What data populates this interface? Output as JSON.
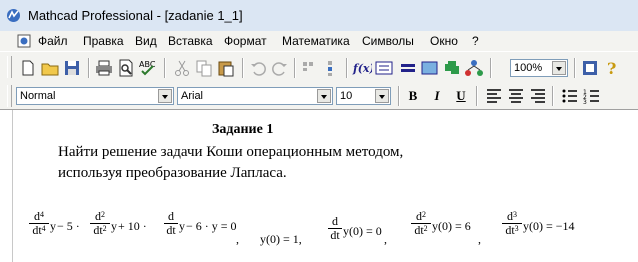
{
  "window": {
    "title": "Mathcad Professional - [zadanie 1_1]"
  },
  "menu": [
    "Файл",
    "Правка",
    "Вид",
    "Вставка",
    "Формат",
    "Математика",
    "Символы",
    "Окно",
    "?"
  ],
  "toolbar": {
    "zoom": "100%"
  },
  "formatbar": {
    "style": "Normal",
    "font": "Arial",
    "size": "10",
    "bold": "B",
    "italic": "I",
    "underline": "U"
  },
  "document": {
    "heading": "Задание 1",
    "line1": "Найти решение задачи Коши операционным методом,",
    "line2": "используя преобразование Лапласа.",
    "equation": {
      "d": "d",
      "dt": "dt",
      "p4": "4",
      "p2": "2",
      "p3": "3",
      "y": "y",
      "minus5": " − 5 · ",
      "plus10": " + 10 · ",
      "minus6": " − 6 · y = 0",
      "comma": ",",
      "ic1": "y(0) = 1,",
      "ic2": "y(0) = 0",
      "ic3": "y(0) = 6",
      "ic4": "y(0) = −14"
    }
  }
}
